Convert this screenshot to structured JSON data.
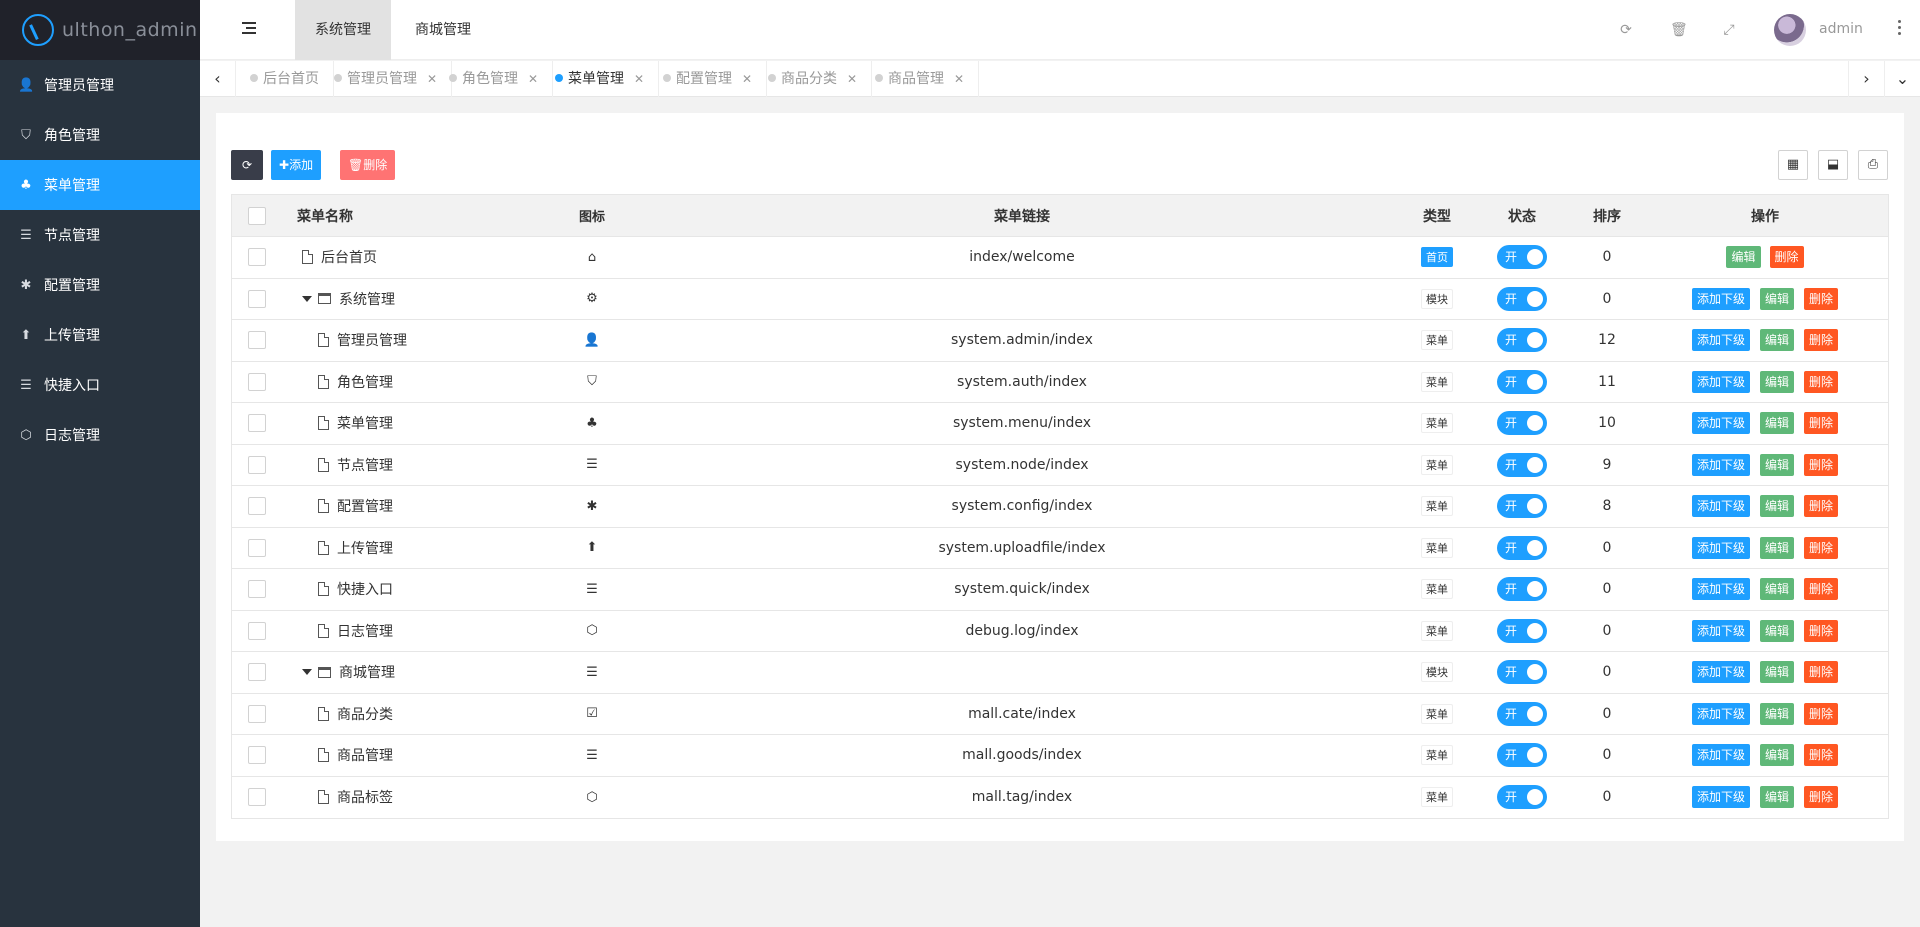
{
  "app": {
    "logo_text": "ulthon_admin"
  },
  "sidebar": {
    "items": [
      {
        "label": "管理员管理",
        "icon": "user-icon",
        "glyph": "👤"
      },
      {
        "label": "角色管理",
        "icon": "shield-icon",
        "glyph": "⛉"
      },
      {
        "label": "菜单管理",
        "icon": "tree-icon",
        "glyph": "♣"
      },
      {
        "label": "节点管理",
        "icon": "list-icon",
        "glyph": "☰"
      },
      {
        "label": "配置管理",
        "icon": "asterisk-icon",
        "glyph": "✱"
      },
      {
        "label": "上传管理",
        "icon": "arrow-up-icon",
        "glyph": "⬆"
      },
      {
        "label": "快捷入口",
        "icon": "list-icon",
        "glyph": "☰"
      },
      {
        "label": "日志管理",
        "icon": "hexagon-icon",
        "glyph": "⬡"
      }
    ],
    "active_index": 2
  },
  "header": {
    "top_tabs": [
      "系统管理",
      "商城管理"
    ],
    "user": "admin"
  },
  "tabs": [
    {
      "label": "后台首页",
      "closable": false
    },
    {
      "label": "管理员管理",
      "closable": true
    },
    {
      "label": "角色管理",
      "closable": true
    },
    {
      "label": "菜单管理",
      "closable": true,
      "active": true
    },
    {
      "label": "配置管理",
      "closable": true
    },
    {
      "label": "商品分类",
      "closable": true
    },
    {
      "label": "商品管理",
      "closable": true
    }
  ],
  "toolbar": {
    "add_label": "添加",
    "delete_label": "删除"
  },
  "table": {
    "headers": {
      "name": "菜单名称",
      "icon": "图标",
      "link": "菜单链接",
      "type": "类型",
      "status": "状态",
      "sort": "排序",
      "op": "操作"
    },
    "switch_on_label": "开",
    "op_labels": {
      "add_child": "添加下级",
      "edit": "编辑",
      "delete": "删除"
    },
    "rows": [
      {
        "name": "后台首页",
        "level": 0,
        "kind": "file",
        "icon": "home-icon",
        "glyph": "⌂",
        "link": "index/welcome",
        "type": "首页",
        "sort": "0",
        "home": true
      },
      {
        "name": "系统管理",
        "level": 0,
        "kind": "folder",
        "icon": "gear-icon",
        "glyph": "⚙",
        "link": "",
        "type": "模块",
        "sort": "0"
      },
      {
        "name": "管理员管理",
        "level": 1,
        "kind": "file",
        "icon": "user-icon",
        "glyph": "👤",
        "link": "system.admin/index",
        "type": "菜单",
        "sort": "12"
      },
      {
        "name": "角色管理",
        "level": 1,
        "kind": "file",
        "icon": "shield-icon",
        "glyph": "⛉",
        "link": "system.auth/index",
        "type": "菜单",
        "sort": "11"
      },
      {
        "name": "菜单管理",
        "level": 1,
        "kind": "file",
        "icon": "tree-icon",
        "glyph": "♣",
        "link": "system.menu/index",
        "type": "菜单",
        "sort": "10"
      },
      {
        "name": "节点管理",
        "level": 1,
        "kind": "file",
        "icon": "list-icon",
        "glyph": "☰",
        "link": "system.node/index",
        "type": "菜单",
        "sort": "9"
      },
      {
        "name": "配置管理",
        "level": 1,
        "kind": "file",
        "icon": "asterisk-icon",
        "glyph": "✱",
        "link": "system.config/index",
        "type": "菜单",
        "sort": "8"
      },
      {
        "name": "上传管理",
        "level": 1,
        "kind": "file",
        "icon": "arrow-up-icon",
        "glyph": "⬆",
        "link": "system.uploadfile/index",
        "type": "菜单",
        "sort": "0"
      },
      {
        "name": "快捷入口",
        "level": 1,
        "kind": "file",
        "icon": "list-icon",
        "glyph": "☰",
        "link": "system.quick/index",
        "type": "菜单",
        "sort": "0"
      },
      {
        "name": "日志管理",
        "level": 1,
        "kind": "file",
        "icon": "hexagon-icon",
        "glyph": "⬡",
        "link": "debug.log/index",
        "type": "菜单",
        "sort": "0"
      },
      {
        "name": "商城管理",
        "level": 0,
        "kind": "folder",
        "icon": "list-icon",
        "glyph": "☰",
        "link": "",
        "type": "模块",
        "sort": "0"
      },
      {
        "name": "商品分类",
        "level": 1,
        "kind": "file",
        "icon": "calendar-icon",
        "glyph": "☑",
        "link": "mall.cate/index",
        "type": "菜单",
        "sort": "0"
      },
      {
        "name": "商品管理",
        "level": 1,
        "kind": "file",
        "icon": "list-icon",
        "glyph": "☰",
        "link": "mall.goods/index",
        "type": "菜单",
        "sort": "0"
      },
      {
        "name": "商品标签",
        "level": 1,
        "kind": "file",
        "icon": "hexagon-icon",
        "glyph": "⬡",
        "link": "mall.tag/index",
        "type": "菜单",
        "sort": "0"
      }
    ]
  },
  "colors": {
    "accent": "#1e9fff",
    "sidebar_bg": "#28333e",
    "danger": "#ff5722",
    "success": "#5fb878"
  }
}
